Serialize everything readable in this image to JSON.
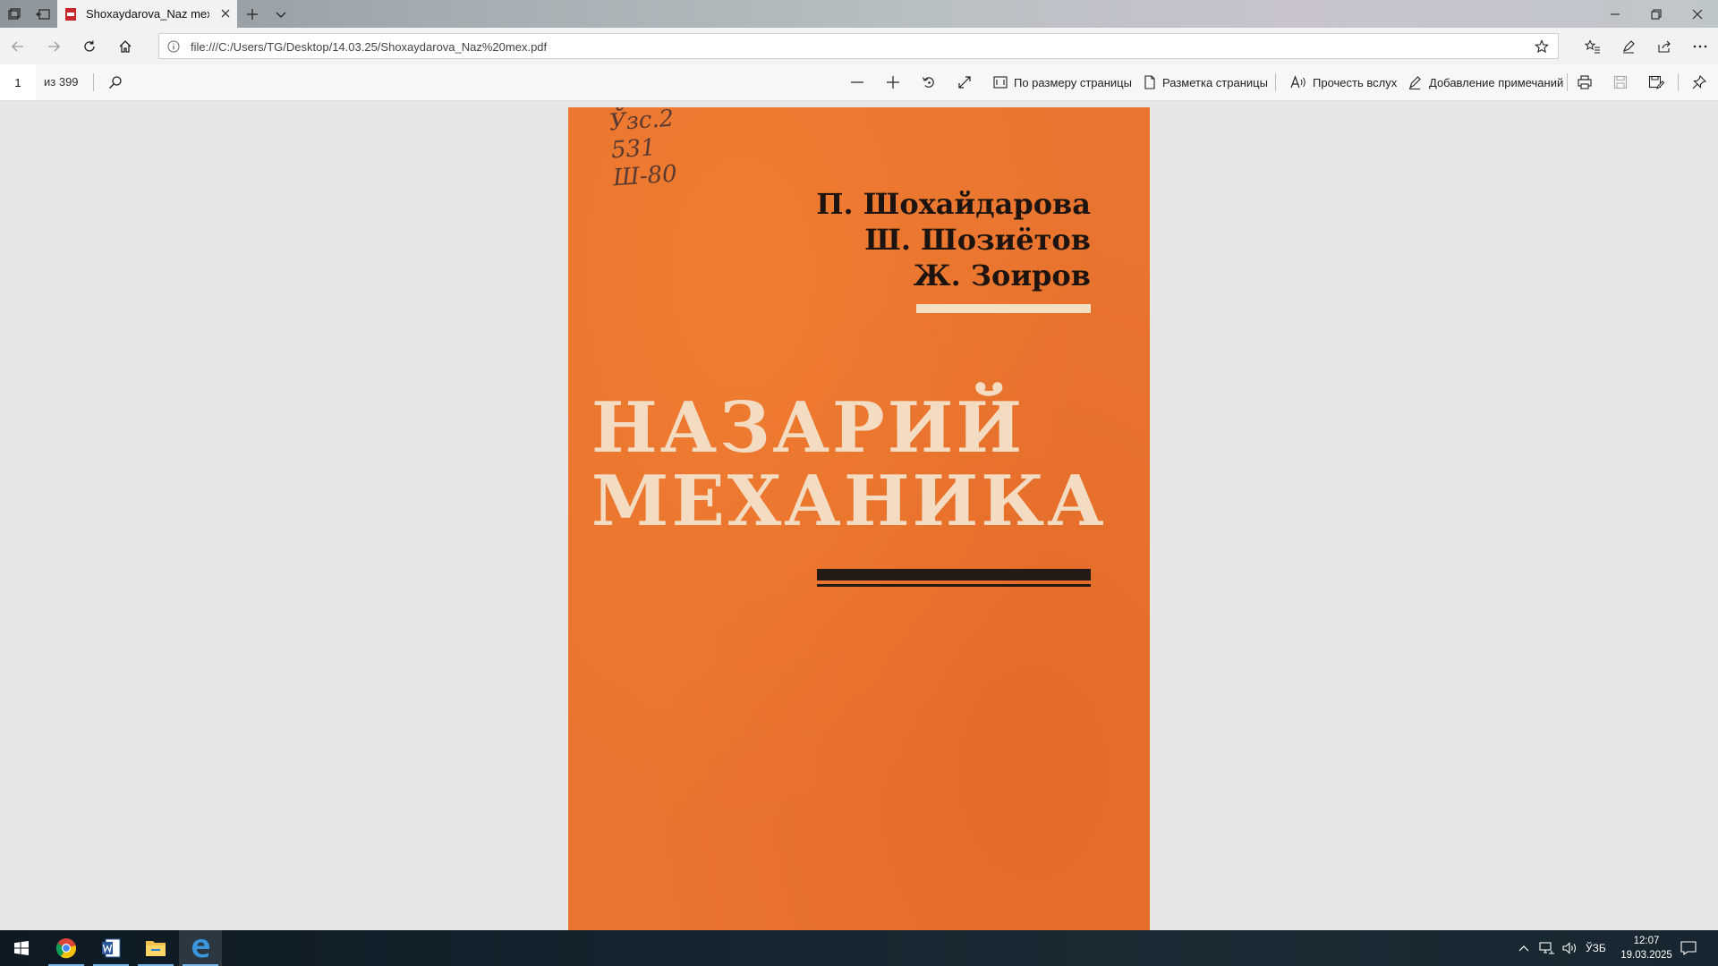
{
  "tabbar": {
    "tab_title": "Shoxaydarova_Naz mex"
  },
  "address_bar": {
    "url": "file:///C:/Users/TG/Desktop/14.03.25/Shoxaydarova_Naz%20mex.pdf"
  },
  "pdf_toolbar": {
    "current_page": "1",
    "page_count": "из 399",
    "fit_page_label": "По размеру страницы",
    "page_layout_label": "Разметка страницы",
    "read_aloud_label": "Прочесть вслух",
    "add_notes_label": "Добавление примечаний"
  },
  "document": {
    "stamp_lines": [
      "Ўзс.2",
      "531",
      "Ш-80"
    ],
    "authors": [
      "П. Шохайдарова",
      "Ш. Шозиётов",
      "Ж. Зоиров"
    ],
    "title_lines": [
      "НАЗАРИЙ",
      "МЕХАНИКА"
    ],
    "cover_color": "#e8742f"
  },
  "taskbar": {
    "language": "ЎЗБ",
    "time": "12:07",
    "date": "19.03.2025",
    "apps": [
      "chrome-icon",
      "word-icon",
      "file-explorer-icon",
      "edge-icon"
    ]
  }
}
